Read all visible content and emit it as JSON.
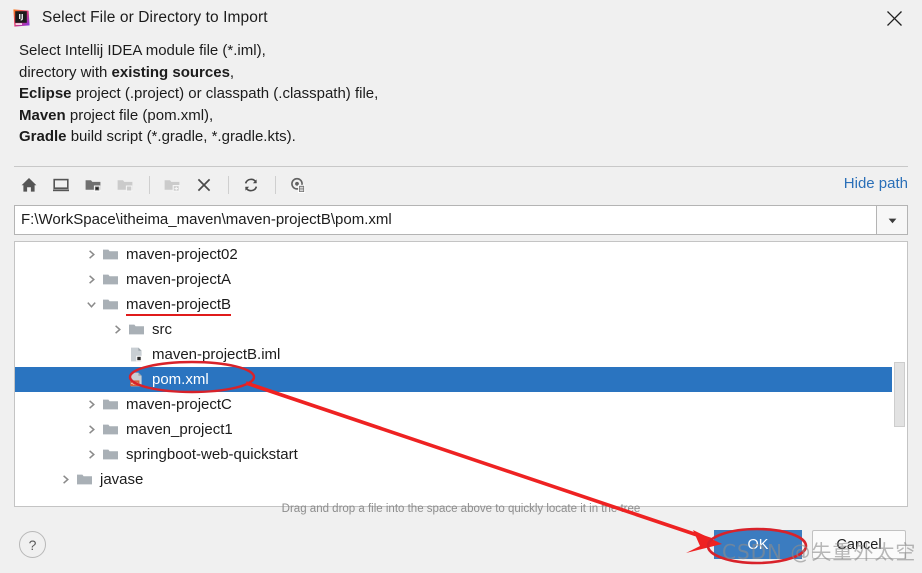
{
  "window": {
    "title": "Select File or Directory to Import",
    "app_icon": "intellij-idea-icon",
    "close_label": "✕"
  },
  "description": {
    "line1_a": "Select Intellij IDEA module file (*.iml),",
    "line2_a": "directory with ",
    "line2_b": "existing sources",
    "line2_c": ",",
    "line3_a": "Eclipse",
    "line3_b": " project (.project) or classpath (.classpath) file,",
    "line4_a": "Maven",
    "line4_b": " project file (pom.xml),",
    "line5_a": "Gradle",
    "line5_b": " build script (*.gradle, *.gradle.kts)."
  },
  "toolbar": {
    "buttons": [
      {
        "name": "home-icon",
        "title": "Home",
        "enabled": true
      },
      {
        "name": "desktop-icon",
        "title": "Desktop",
        "enabled": true
      },
      {
        "name": "folder-up-icon",
        "title": "Up",
        "enabled": true
      },
      {
        "name": "folder-icon",
        "title": "Project Dir",
        "enabled": false
      },
      {
        "name": "new-folder-icon",
        "title": "New Folder",
        "enabled": false
      },
      {
        "name": "delete-icon",
        "title": "Delete",
        "enabled": true
      },
      {
        "name": "refresh-icon",
        "title": "Refresh",
        "enabled": true
      },
      {
        "name": "show-hidden-icon",
        "title": "Show Hidden Files",
        "enabled": true
      }
    ],
    "hide_path_label": "Hide path"
  },
  "path_field": {
    "value": "F:\\WorkSpace\\itheima_maven\\maven-projectB\\pom.xml",
    "placeholder": "",
    "dropdown_icon": "chevron-down-icon"
  },
  "tree": {
    "rows": [
      {
        "label": "maven-project02",
        "indent": 2,
        "arrow": "collapsed",
        "icon": "folder",
        "selected": false,
        "underline": false
      },
      {
        "label": "maven-projectA",
        "indent": 2,
        "arrow": "collapsed",
        "icon": "folder",
        "selected": false,
        "underline": false
      },
      {
        "label": "maven-projectB",
        "indent": 2,
        "arrow": "expanded",
        "icon": "folder",
        "selected": false,
        "underline": true
      },
      {
        "label": "src",
        "indent": 3,
        "arrow": "collapsed",
        "icon": "folder",
        "selected": false,
        "underline": false
      },
      {
        "label": "maven-projectB.iml",
        "indent": 3,
        "arrow": "none",
        "icon": "iml-file",
        "selected": false,
        "underline": false
      },
      {
        "label": "pom.xml",
        "indent": 3,
        "arrow": "none",
        "icon": "xml-file",
        "selected": true,
        "underline": false
      },
      {
        "label": "maven-projectC",
        "indent": 2,
        "arrow": "collapsed",
        "icon": "folder",
        "selected": false,
        "underline": false
      },
      {
        "label": "maven_project1",
        "indent": 2,
        "arrow": "collapsed",
        "icon": "folder",
        "selected": false,
        "underline": false
      },
      {
        "label": "springboot-web-quickstart",
        "indent": 2,
        "arrow": "collapsed",
        "icon": "folder",
        "selected": false,
        "underline": false
      },
      {
        "label": "javase",
        "indent": 1,
        "arrow": "collapsed",
        "icon": "folder",
        "selected": false,
        "underline": false
      }
    ]
  },
  "hint": {
    "text": "Drag and drop a file into the space above to quickly locate it in the tree"
  },
  "footer": {
    "help_label": "?",
    "ok_label": "OK",
    "cancel_label": "Cancel"
  },
  "annotations": {
    "watermark_text": "CSDN @失重外太空",
    "accent_red": "#e01b1b",
    "selection_blue": "#2a74c0",
    "link_blue": "#2a6fb8"
  }
}
